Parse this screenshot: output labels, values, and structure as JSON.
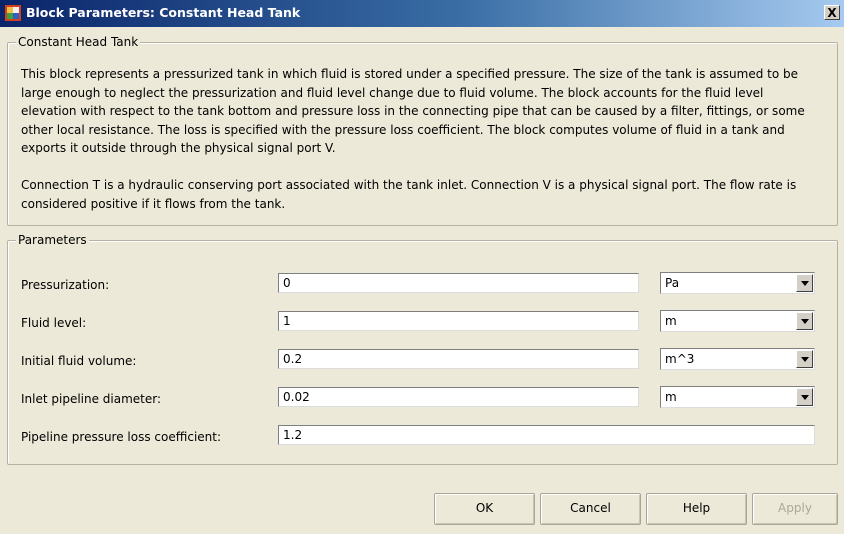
{
  "window": {
    "title": "Block Parameters: Constant Head Tank",
    "close_label": "X"
  },
  "description_group": {
    "legend": "Constant Head Tank",
    "paragraph1": "This block represents a pressurized tank in which fluid is stored under a specified pressure. The size of the tank is assumed to be large enough to neglect the pressurization and fluid level change due to fluid volume. The block accounts for the fluid level elevation with respect to the tank bottom and pressure loss in the connecting pipe that can be caused by a filter, fittings, or some other local resistance. The loss is specified with the pressure loss coefficient. The block computes volume of fluid in a tank and exports it outside through the physical signal port V.",
    "paragraph2": "Connection T is a hydraulic conserving port associated with the tank inlet. Connection V is a physical signal port. The flow rate is considered positive if it flows from the tank."
  },
  "parameters_group": {
    "legend": "Parameters",
    "rows": [
      {
        "label": "Pressurization:",
        "value": "0",
        "unit": "Pa"
      },
      {
        "label": "Fluid level:",
        "value": "1",
        "unit": "m"
      },
      {
        "label": "Initial fluid volume:",
        "value": "0.2",
        "unit": "m^3"
      },
      {
        "label": "Inlet pipeline diameter:",
        "value": "0.02",
        "unit": "m"
      },
      {
        "label": "Pipeline pressure loss coefficient:",
        "value": "1.2"
      }
    ]
  },
  "buttons": {
    "ok": "OK",
    "cancel": "Cancel",
    "help": "Help",
    "apply": "Apply"
  },
  "colors": {
    "titlebar_start": "#0a246a",
    "titlebar_end": "#a6caf0",
    "dialog_background": "#ece9d8"
  },
  "icons": {
    "app": "simulink-block-icon",
    "close": "close-icon",
    "dropdown": "chevron-down-icon"
  }
}
